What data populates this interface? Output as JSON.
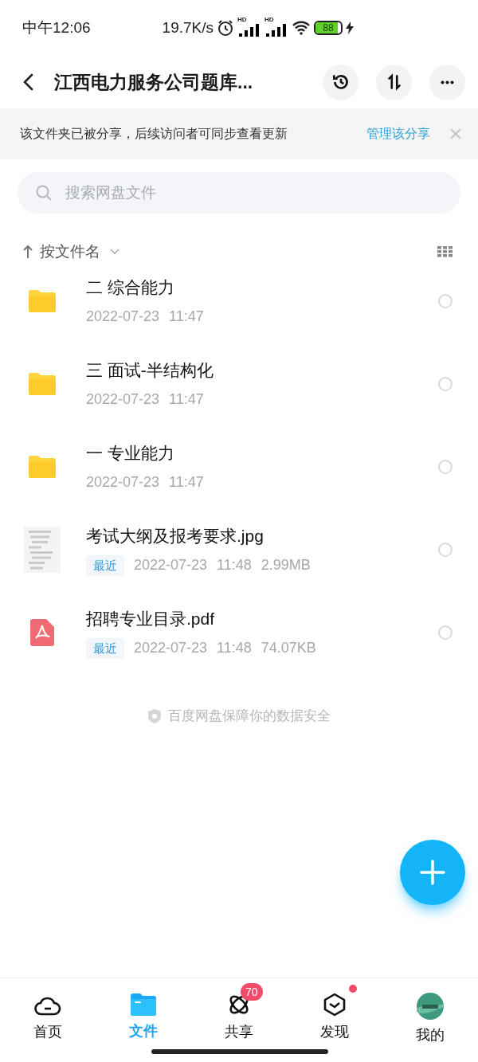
{
  "status_bar": {
    "time": "中午12:06",
    "net_speed": "19.7K/s",
    "signal_labels": [
      "HD",
      "HD"
    ],
    "battery": "88",
    "charging": true
  },
  "header": {
    "title": "江西电力服务公司题库..."
  },
  "share_banner": {
    "text": "该文件夹已被分享，后续访问者可同步查看更新",
    "link": "管理该分享"
  },
  "search": {
    "placeholder": "搜索网盘文件"
  },
  "sort": {
    "label": "按文件名"
  },
  "files": [
    {
      "kind": "folder",
      "name": "二 综合能力",
      "date": "2022-07-23",
      "time": "11:47",
      "selected": false
    },
    {
      "kind": "folder",
      "name": "三 面试-半结构化",
      "date": "2022-07-23",
      "time": "11:47",
      "selected": false
    },
    {
      "kind": "folder",
      "name": "一 专业能力",
      "date": "2022-07-23",
      "time": "11:47",
      "selected": false
    },
    {
      "name": "考试大纲及报考要求.jpg",
      "tag": "最近",
      "date": "2022-07-23",
      "time": "11:48",
      "size": "2.99MB",
      "selected": false
    },
    {
      "kind": "pdf",
      "name": "招聘专业目录.pdf",
      "tag": "最近",
      "date": "2022-07-23",
      "time": "11:48",
      "size": "74.07KB",
      "selected": false
    }
  ],
  "security_note": "百度网盘保障你的数据安全",
  "tabs": [
    {
      "kind": "home",
      "label": "首页",
      "selected": false
    },
    {
      "kind": "files",
      "label": "文件",
      "selected": true
    },
    {
      "kind": "share",
      "label": "共享",
      "selected": false,
      "badge": "70"
    },
    {
      "kind": "discover",
      "label": "发现",
      "selected": false,
      "dot": true
    },
    {
      "kind": "me",
      "label": "我的",
      "selected": false
    }
  ]
}
